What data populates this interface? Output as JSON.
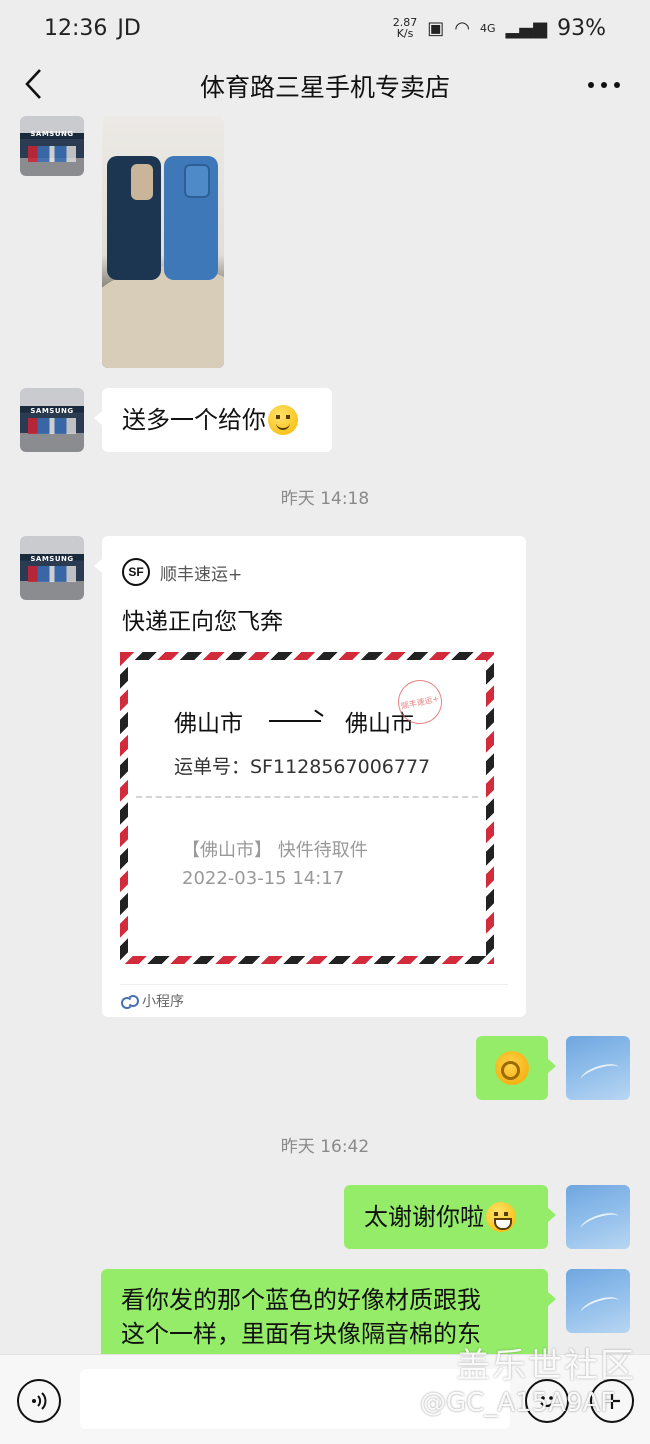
{
  "status_bar": {
    "time": "12:36",
    "carrier": "JD",
    "net_speed_value": "2.87",
    "net_speed_unit": "K/s",
    "signal": "4G",
    "battery": "93%"
  },
  "header": {
    "title": "体育路三星手机专卖店"
  },
  "store_avatar_text": "SAMSUNG",
  "messages": {
    "gift_text": "送多一个给你",
    "timestamp_1": "昨天 14:18",
    "timestamp_2": "昨天 16:42",
    "thanks_text": "太谢谢你啦",
    "long_text_line1": "看你发的那个蓝色的好像材质跟我",
    "long_text_line2": "这个一样，里面有块像隔音棉的东"
  },
  "express_card": {
    "brand": "顺丰速运+",
    "brand_logo": "SF",
    "title": "快递正向您飞奔",
    "from_city": "佛山市",
    "to_city": "佛山市",
    "stamp_text": "顺丰速运+",
    "waybill": "运单号：SF1128567006777",
    "status": "【佛山市】 快件待取件",
    "status_time": "2022-03-15 14:17",
    "footer": "小程序"
  },
  "input_bar": {
    "voice_icon": "voice-icon",
    "emoji_icon": "emoji-icon",
    "plus_icon": "plus-icon"
  },
  "watermark": {
    "line1": "盖乐世社区",
    "line2": "@GC_A15A9AF"
  }
}
